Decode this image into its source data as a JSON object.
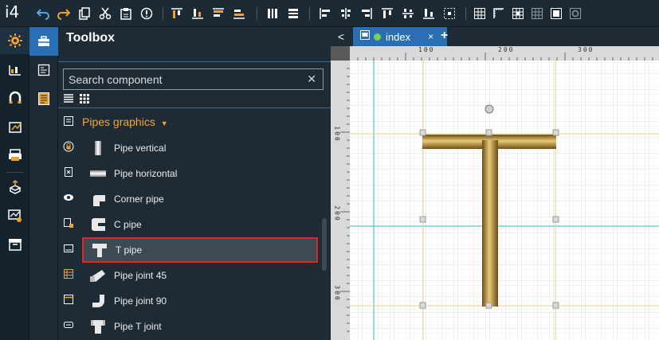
{
  "app": {
    "logo": "i4"
  },
  "toolbar": {
    "buttons": [
      "undo-icon",
      "redo-icon",
      "copy-icon",
      "cut-icon",
      "paste-icon",
      "delete-icon",
      "align-top-icon",
      "align-bottom-icon",
      "align-top-2-icon",
      "align-bottom-2-icon",
      "distribute-h-icon",
      "distribute-v-icon",
      "align-left-icon",
      "align-center-icon",
      "align-right-icon",
      "align-top-edge-icon",
      "align-middle-icon",
      "align-bottom-edge-icon",
      "center-icon",
      "grid-icon",
      "ruler-icon",
      "grid-snap-icon",
      "grid-dots-icon",
      "group-icon",
      "ungroup-icon"
    ]
  },
  "panel": {
    "title": "Toolbox",
    "search_placeholder": "Search component",
    "group_title": "Pipes graphics",
    "items": [
      {
        "label": "Pipe vertical"
      },
      {
        "label": "Pipe horizontal"
      },
      {
        "label": "Corner pipe"
      },
      {
        "label": "C pipe"
      },
      {
        "label": "T pipe"
      },
      {
        "label": "Pipe joint 45"
      },
      {
        "label": "Pipe joint 90"
      },
      {
        "label": "Pipe T joint"
      }
    ],
    "selected_item": "T pipe"
  },
  "tabs": {
    "active_label": "index",
    "close_symbol": "×",
    "add_symbol": "+",
    "back_symbol": "<"
  },
  "canvas": {
    "ruler_top_labels": [
      "100",
      "200",
      "300"
    ],
    "ruler_left_labels": [
      "100",
      "200",
      "300"
    ]
  },
  "colors": {
    "accent": "#2a6fb4",
    "highlight": "#f2a63a",
    "selection_border": "#d42b2b",
    "pipe": "#b8862a"
  }
}
